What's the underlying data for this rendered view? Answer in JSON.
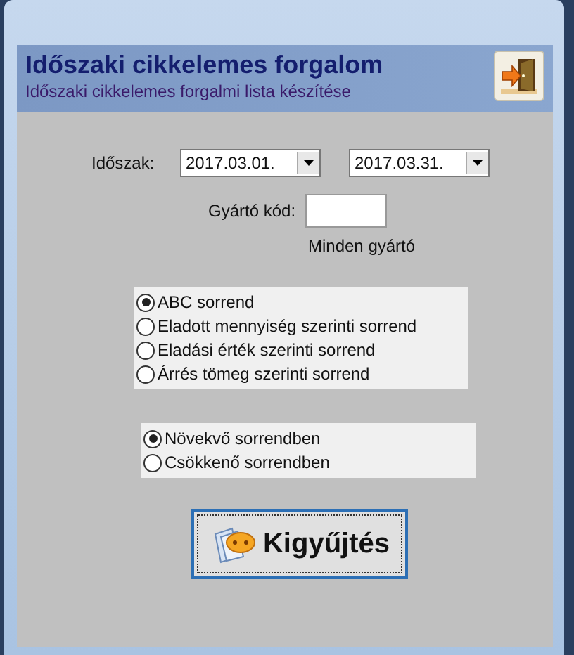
{
  "header": {
    "title": "Időszaki cikkelemes forgalom",
    "subtitle": "Időszaki cikkelemes forgalmi lista készítése"
  },
  "period": {
    "label": "Időszak:",
    "from": "2017.03.01.",
    "to": "2017.03.31."
  },
  "manufacturer": {
    "label": "Gyártó kód:",
    "note": "Minden gyártó"
  },
  "sort_options": [
    {
      "label": "ABC sorrend",
      "selected": true
    },
    {
      "label": "Eladott mennyiség szerinti sorrend",
      "selected": false
    },
    {
      "label": "Eladási érték szerinti sorrend",
      "selected": false
    },
    {
      "label": "Árrés tömeg szerinti sorrend",
      "selected": false
    }
  ],
  "direction_options": [
    {
      "label": "Növekvő sorrendben",
      "selected": true
    },
    {
      "label": "Csökkenő sorrendben",
      "selected": false
    }
  ],
  "button": {
    "label": "Kigyűjtés"
  }
}
